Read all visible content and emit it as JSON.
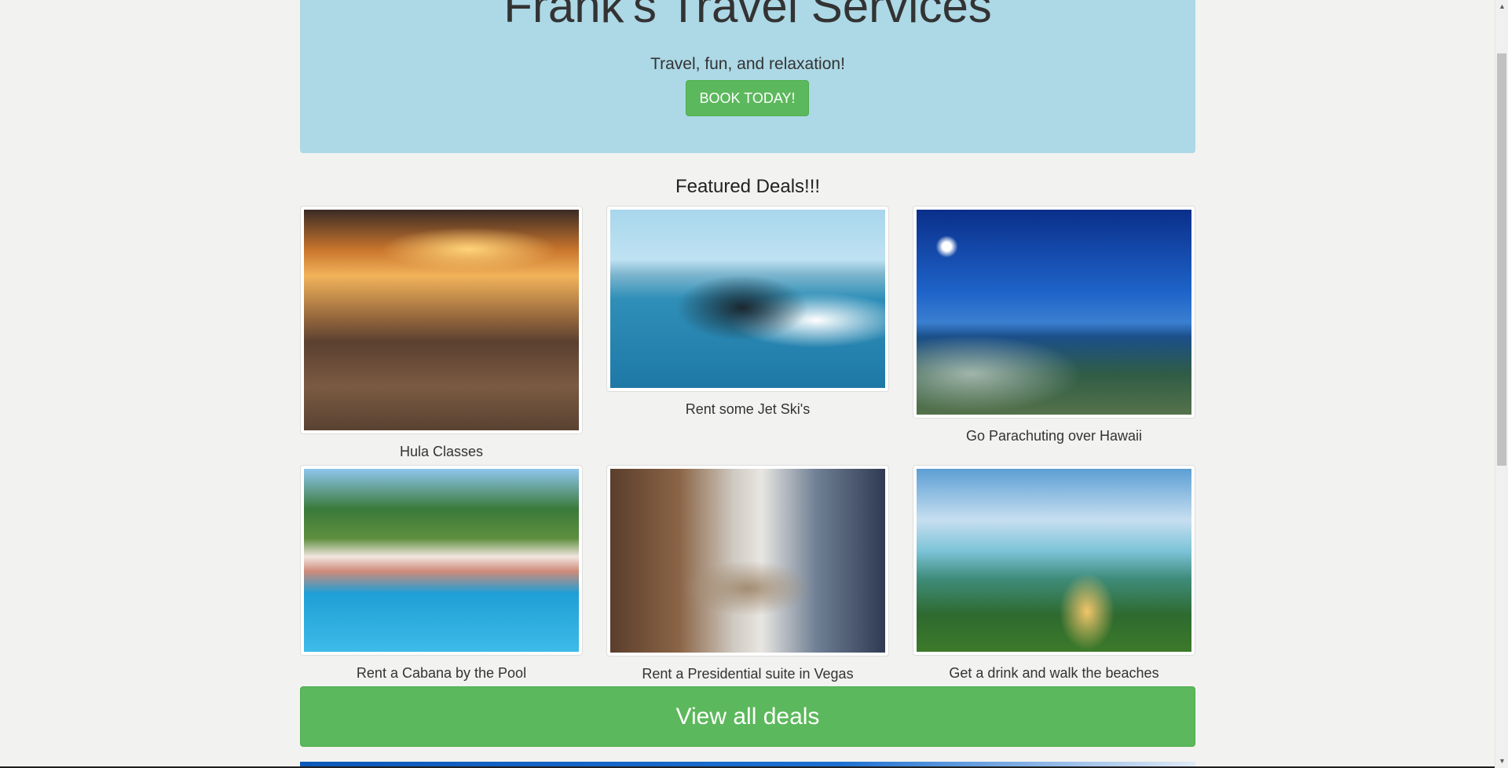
{
  "hero": {
    "title": "Frank's Travel Services",
    "tagline": "Travel, fun, and relaxation!",
    "book_button": "BOOK TODAY!"
  },
  "deals": {
    "heading": "Featured Deals!!!",
    "items": [
      {
        "caption": "Hula Classes"
      },
      {
        "caption": "Rent some Jet Ski's"
      },
      {
        "caption": "Go Parachuting over Hawaii"
      },
      {
        "caption": "Rent a Cabana by the Pool"
      },
      {
        "caption": "Rent a Presidential suite in Vegas"
      },
      {
        "caption": "Get a drink and walk the beaches"
      }
    ],
    "view_all_button": "View all deals"
  },
  "colors": {
    "hero_background": "#add8e6",
    "button_green": "#5cb85c",
    "page_background": "#f2f2f0"
  }
}
